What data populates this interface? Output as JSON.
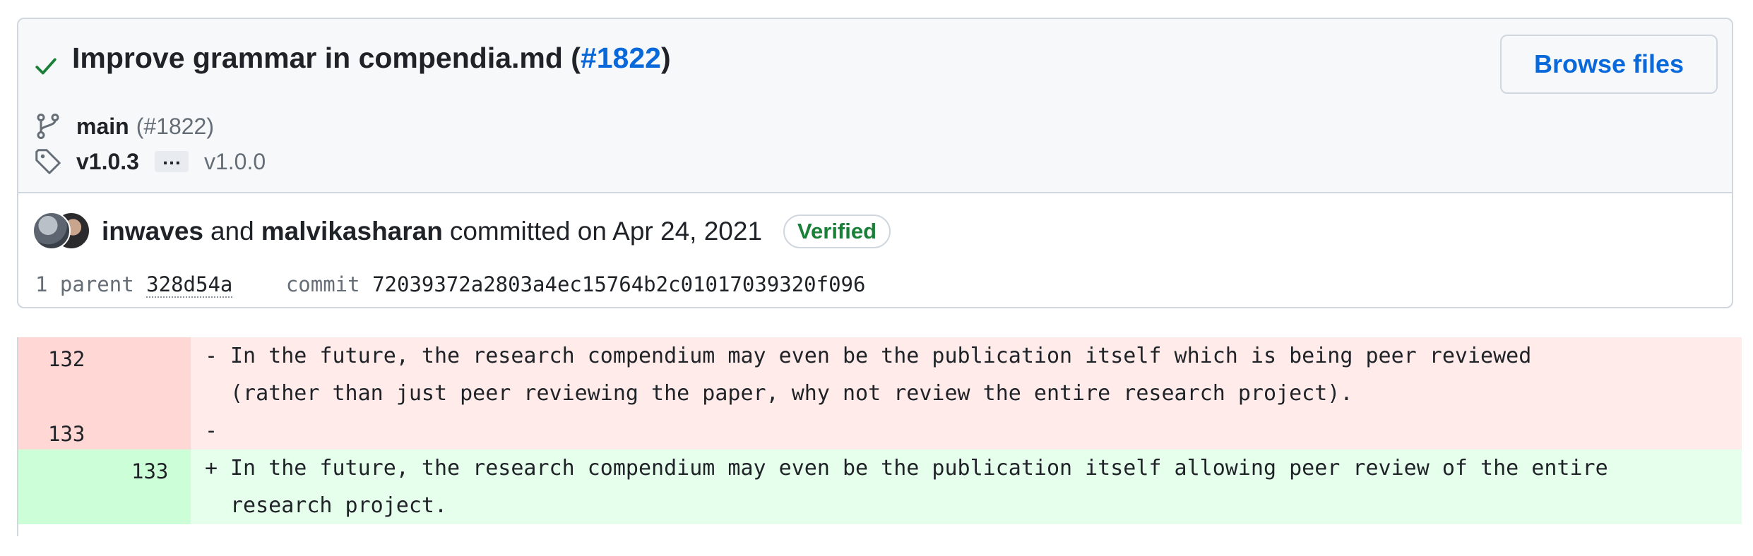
{
  "commit": {
    "title_text": "Improve grammar in compendia.md (",
    "title_pr": "#1822",
    "title_close": ")",
    "browse_label": "Browse files",
    "branch": "main",
    "branch_pr": "(#1822)",
    "tag_latest": "v1.0.3",
    "tag_ellipsis": "…",
    "tag_oldest": "v1.0.0",
    "author1": "inwaves",
    "and_word": "and",
    "author2": "malvikasharan",
    "committed_text": "committed on Apr 24, 2021",
    "verified_label": "Verified",
    "parent_label": "1 parent",
    "parent_sha": "328d54a",
    "commit_label": "commit",
    "commit_sha": "72039372a2803a4ec15764b2c01017039320f096"
  },
  "diff": {
    "rows": [
      {
        "type": "deletion",
        "old_line": "132",
        "marker": "-",
        "lines": [
          "In the future, the research compendium may even be the publication itself which is being peer reviewed",
          "(rather than just peer reviewing the paper, why not review the entire research project)."
        ]
      },
      {
        "type": "deletion",
        "old_line": "133",
        "marker": "-",
        "lines": [
          ""
        ]
      },
      {
        "type": "addition",
        "new_line": "133",
        "marker": "+",
        "lines": [
          "In the future, the research compendium may even be the publication itself allowing peer review of the entire",
          "research project."
        ]
      }
    ]
  },
  "colors": {
    "link": "#0969da",
    "verified": "#1a7f37",
    "deletion_bg": "#ffebe9",
    "deletion_gutter": "#ffd7d5",
    "addition_bg": "#e6ffec",
    "addition_gutter": "#ccffd8"
  },
  "icons": {
    "status": "check-icon",
    "branch": "git-branch-icon",
    "tag": "tag-icon"
  }
}
